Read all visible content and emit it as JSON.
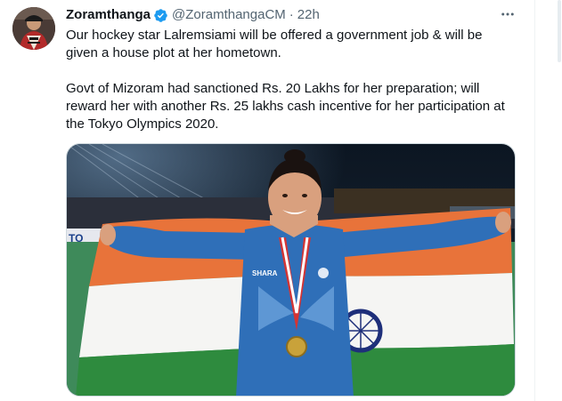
{
  "tweet": {
    "author_name": "Zoramthanga",
    "author_handle": "@ZoramthangaCM",
    "separator": "·",
    "time": "22h",
    "text_line1": "Our hockey star Lalremsiami will be offered a government job & will be",
    "text_line2": "given a house plot at her hometown.",
    "text_line3": "Govt of Mizoram had sanctioned Rs. 20 Lakhs for her preparation; will",
    "text_line4": "reward her with another Rs. 25 lakhs cash incentive for her participation at",
    "text_line5": "the Tokyo Olympics 2020.",
    "more_icon": "more-horizontal-icon",
    "verified_icon": "verified-badge-icon",
    "verified_color": "#1d9bf0"
  },
  "media": {
    "banner_fragment": "TO",
    "jersey_text": "SHARA"
  },
  "colors": {
    "text_primary": "#0f1419",
    "text_secondary": "#536471",
    "saffron": "#e8733a",
    "flag_green": "#2e8b3e",
    "chakra_blue": "#1e2f7a",
    "jersey_blue": "#2f6fb8"
  }
}
